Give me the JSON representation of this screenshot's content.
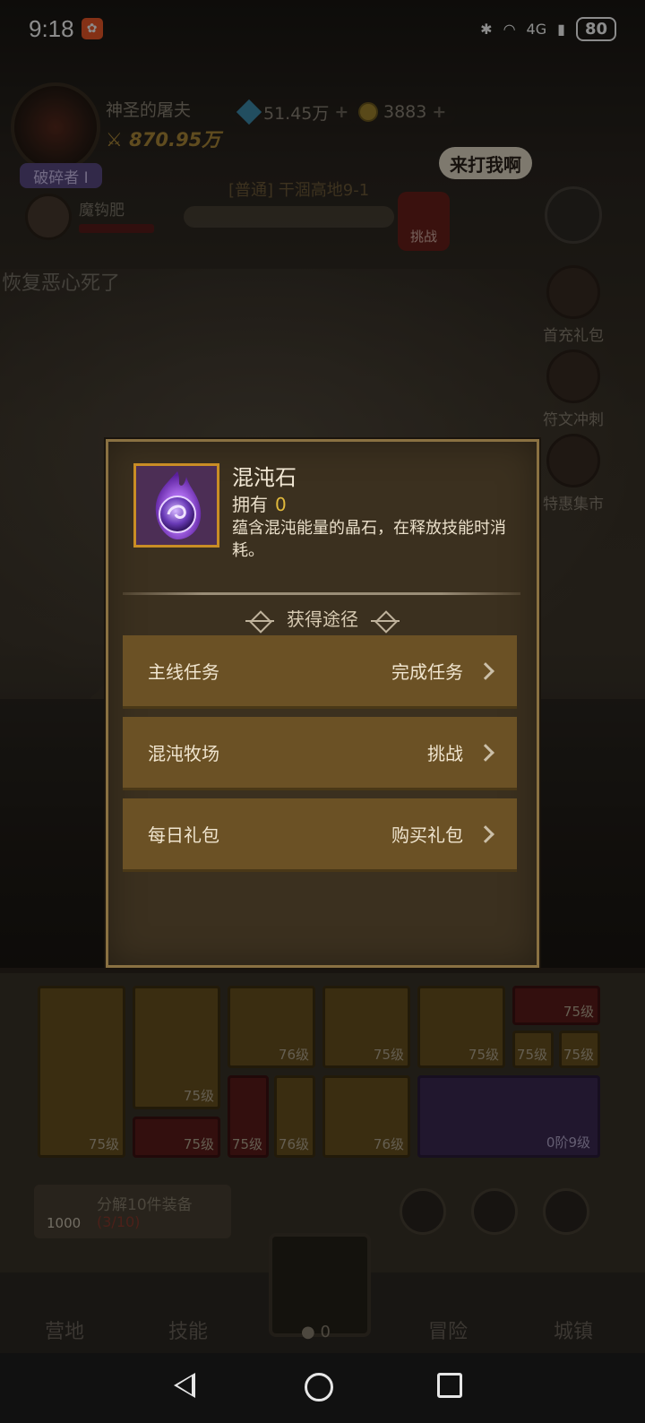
{
  "status_bar": {
    "time": "9:18",
    "battery": "80",
    "network": "4G"
  },
  "hud": {
    "player_name": "神圣的屠夫",
    "power": "870.95万",
    "rank_badge": "破碎者 I",
    "gems": "51.45万",
    "coins": "3883",
    "pet_name": "魔钩肥",
    "stage": "[普通] 干涸高地9-1",
    "challenge": "挑战",
    "speech": "来打我啊",
    "chat_message": "恢复恶心死了"
  },
  "side_buttons": [
    {
      "label": "首充礼包"
    },
    {
      "label": "符文冲刺"
    },
    {
      "label": "特惠集市"
    }
  ],
  "modal": {
    "item_name": "混沌石",
    "own_label": "拥有",
    "own_count": "0",
    "description": "蕴含混沌能量的晶石，在释放技能时消耗。",
    "section_title": "获得途径",
    "sources": [
      {
        "name": "主线任务",
        "action": "完成任务"
      },
      {
        "name": "混沌牧场",
        "action": "挑战"
      },
      {
        "name": "每日礼包",
        "action": "购买礼包"
      }
    ]
  },
  "equipment": {
    "levels": [
      "75级",
      "75级",
      "76级",
      "75级",
      "75级",
      "75级",
      "75级",
      "75级",
      "75级",
      "75级",
      "76级",
      "76级"
    ],
    "wing_level": "0阶9级",
    "salvage_label": "分解10件装备",
    "salvage_progress": "(3/10)",
    "salvage_gems": "1000"
  },
  "bottom_nav": [
    {
      "label": "营地"
    },
    {
      "label": "技能"
    },
    {
      "label": "冒险"
    },
    {
      "label": "城镇"
    }
  ],
  "center_count": "0",
  "colors": {
    "accent_gold": "#c98d25",
    "row_brown": "#6b5125",
    "own_count": "#e1b93c"
  }
}
